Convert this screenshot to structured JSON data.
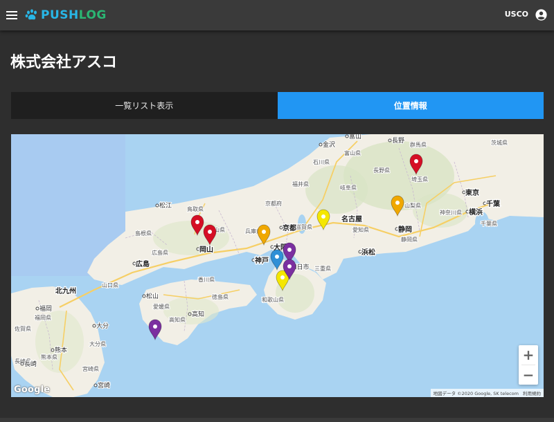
{
  "header": {
    "logo_push": "PUSH",
    "logo_log": "LOG",
    "user_label": "USCO"
  },
  "page": {
    "title": "株式会社アスコ"
  },
  "tabs": [
    {
      "label": "一覧リスト表示",
      "active": false
    },
    {
      "label": "位置情報",
      "active": true
    }
  ],
  "map": {
    "google_label": "Google",
    "attribution": "地図データ ©2020 Google, SK telecom",
    "terms": "利用規約",
    "zoom_in": "+",
    "zoom_out": "−",
    "major_cities": [
      "東京",
      "横浜",
      "千葉",
      "名古屋",
      "京都",
      "大阪",
      "神戸",
      "岡山",
      "広島",
      "北九州",
      "静岡",
      "浜松"
    ],
    "cities": [
      "金沢",
      "富山",
      "長野",
      "松江",
      "高知",
      "松山",
      "福岡",
      "熊本",
      "大分",
      "宮崎",
      "長崎",
      "四日市"
    ],
    "prefectures": [
      "石川県",
      "富山県",
      "長野県",
      "群馬県",
      "茨城県",
      "埼玉県",
      "山梨県",
      "神奈川県",
      "千葉県",
      "静岡県",
      "愛知県",
      "岐阜県",
      "福井県",
      "滋賀県",
      "三重県",
      "和歌山県",
      "京都府",
      "兵庫県",
      "鳥取県",
      "島根県",
      "岡山県",
      "広島県",
      "山口県",
      "香川県",
      "徳島県",
      "愛媛県",
      "高知県",
      "福岡県",
      "佐賀県",
      "長崎県",
      "熊本県",
      "大分県",
      "宮崎県"
    ],
    "pins": [
      {
        "color": "#d50f25"
      },
      {
        "color": "#d50f25"
      },
      {
        "color": "#d50f25"
      },
      {
        "color": "#f0a800"
      },
      {
        "color": "#f0a800"
      },
      {
        "color": "#f5e700"
      },
      {
        "color": "#f5e700"
      },
      {
        "color": "#7b2fa0"
      },
      {
        "color": "#7b2fa0"
      },
      {
        "color": "#7b2fa0"
      },
      {
        "color": "#2f8fd6"
      }
    ]
  },
  "colors": {
    "accent": "#2196f3",
    "topbar": "#3a3a3a",
    "background": "#2e2e2e"
  }
}
